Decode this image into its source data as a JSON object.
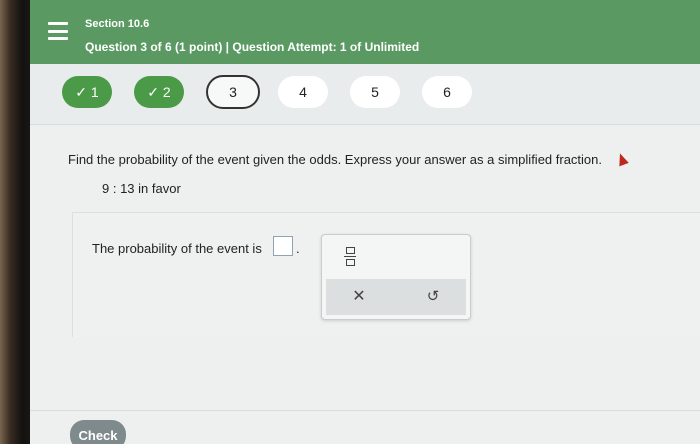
{
  "header": {
    "section": "Section 10.6",
    "question_info": "Question 3 of 6 (1 point)  |  Question Attempt: 1 of Unlimited"
  },
  "navigation": {
    "questions": [
      {
        "label": "✓ 1",
        "state": "completed"
      },
      {
        "label": "✓ 2",
        "state": "completed"
      },
      {
        "label": "3",
        "state": "current"
      },
      {
        "label": "4",
        "state": "unanswered"
      },
      {
        "label": "5",
        "state": "unanswered"
      },
      {
        "label": "6",
        "state": "unanswered"
      }
    ]
  },
  "problem": {
    "prompt": "Find the probability of the event given the odds. Express your answer as a simplified fraction.",
    "odds": "9 : 13 in favor"
  },
  "answer": {
    "label": "The probability of the event is",
    "value": "",
    "suffix": "."
  },
  "palette": {
    "clear_symbol": "✕",
    "undo_symbol": "↺"
  },
  "footer": {
    "check_label": "Check"
  },
  "colors": {
    "header_green": "#5a9a62",
    "completed_green": "#4a9a48",
    "check_button": "#7f8a8c"
  }
}
